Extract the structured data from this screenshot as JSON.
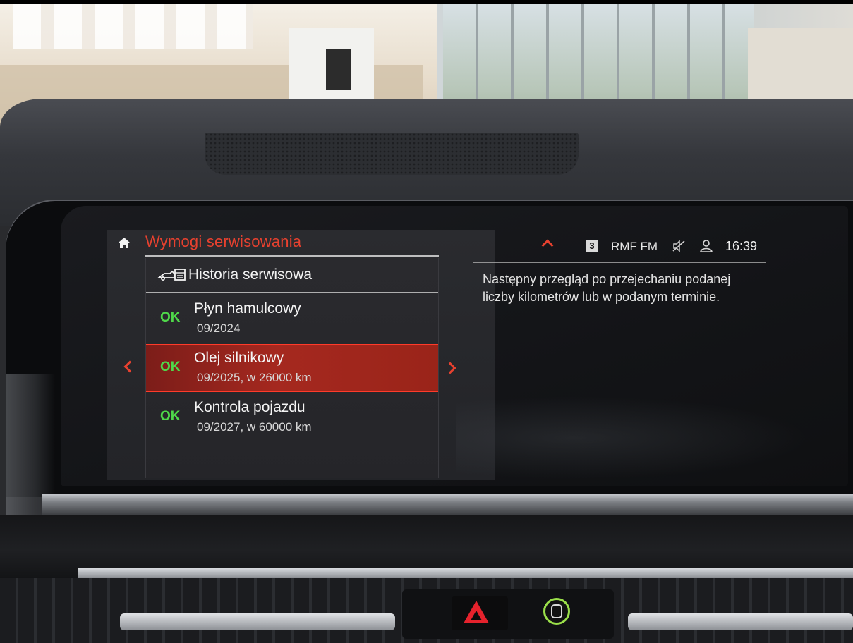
{
  "colors": {
    "accent_red": "#e8412f",
    "ok_green": "#4fd84a",
    "selection_red": "#a5281f",
    "screen_bg": "#131417"
  },
  "header": {
    "home_icon": "home-icon",
    "title": "Wymogi serwisowania"
  },
  "list": {
    "header_icon": "service-history-icon",
    "header_label": "Historia serwisowa",
    "items": [
      {
        "status": "OK",
        "name": "Płyn hamulcowy",
        "detail": "09/2024",
        "selected": false
      },
      {
        "status": "OK",
        "name": "Olej silnikowy",
        "detail": "09/2025, w 26000 km",
        "selected": true
      },
      {
        "status": "OK",
        "name": "Kontrola pojazdu",
        "detail": "09/2027, w 60000 km",
        "selected": false
      }
    ]
  },
  "status_bar": {
    "preset": "3",
    "station": "RMF FM",
    "mute_icon": "mute-icon",
    "profile_icon": "profile-icon",
    "time": "16:39"
  },
  "info": {
    "text": "Następny przegląd po przejechaniu podanej liczby kilometrów lub w podanym terminie."
  }
}
